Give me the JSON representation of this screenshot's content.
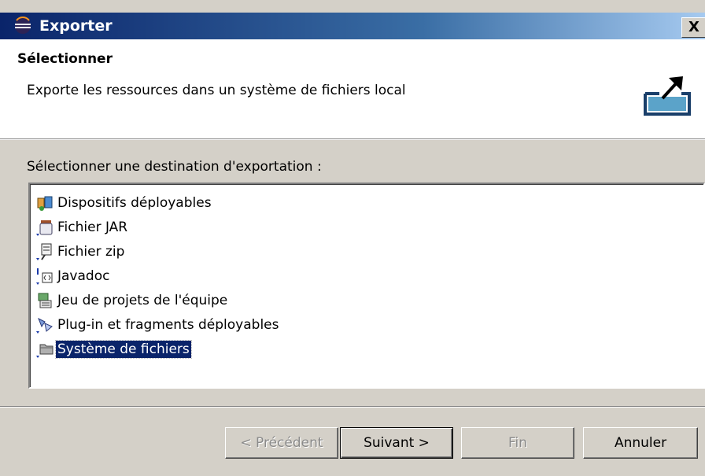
{
  "window": {
    "title": "Exporter",
    "close_label": "X"
  },
  "header": {
    "title": "Sélectionner",
    "description": "Exporte les ressources dans un système de fichiers local",
    "icon": "export-icon"
  },
  "group": {
    "label": "Sélectionner une destination d'exportation :"
  },
  "list": {
    "items": [
      {
        "label": "Dispositifs déployables",
        "icon": "deployable-devices-icon"
      },
      {
        "label": "Fichier JAR",
        "icon": "jar-file-icon"
      },
      {
        "label": "Fichier zip",
        "icon": "zip-file-icon"
      },
      {
        "label": "Javadoc",
        "icon": "javadoc-icon"
      },
      {
        "label": "Jeu de projets de l'équipe",
        "icon": "team-project-set-icon"
      },
      {
        "label": "Plug-in et fragments déployables",
        "icon": "plugin-fragments-icon"
      },
      {
        "label": "Système de fichiers",
        "icon": "file-system-icon",
        "selected": true
      }
    ]
  },
  "buttons": {
    "back": "< Précédent",
    "next": "Suivant >",
    "finish": "Fin",
    "cancel": "Annuler"
  },
  "colors": {
    "titlebar": "#0a246a",
    "selection": "#0a246a",
    "face": "#d4d0c8"
  }
}
